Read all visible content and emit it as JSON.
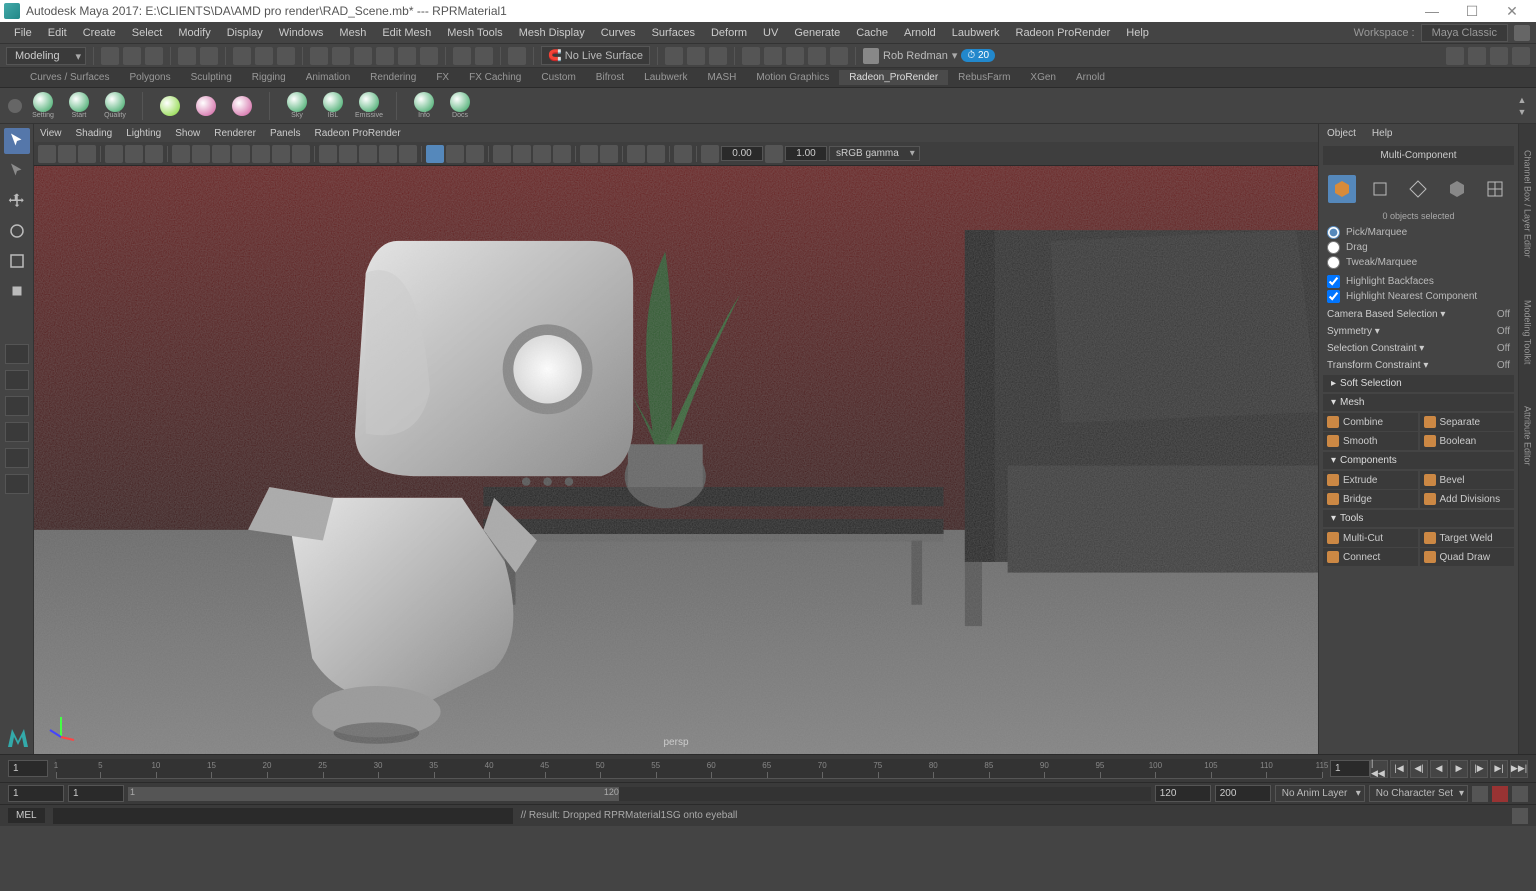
{
  "title": "Autodesk Maya 2017: E:\\CLIENTS\\DA\\AMD pro render\\RAD_Scene.mb*  ---  RPRMaterial1",
  "menus": [
    "File",
    "Edit",
    "Create",
    "Select",
    "Modify",
    "Display",
    "Windows",
    "Mesh",
    "Edit Mesh",
    "Mesh Tools",
    "Mesh Display",
    "Curves",
    "Surfaces",
    "Deform",
    "UV",
    "Generate",
    "Cache",
    "Arnold",
    "Laubwerk",
    "Radeon ProRender",
    "Help"
  ],
  "workspace": {
    "label": "Workspace :",
    "value": "Maya Classic"
  },
  "modedrop": "Modeling",
  "livesurface": "No Live Surface",
  "user": {
    "name": "Rob Redman",
    "badge": "20"
  },
  "shelves": [
    "Curves / Surfaces",
    "Polygons",
    "Sculpting",
    "Rigging",
    "Animation",
    "Rendering",
    "FX",
    "FX Caching",
    "Custom",
    "Bifrost",
    "Laubwerk",
    "MASH",
    "Motion Graphics",
    "Radeon_ProRender",
    "RebusFarm",
    "XGen",
    "Arnold"
  ],
  "shelf_active": "Radeon_ProRender",
  "shelf_icons": [
    {
      "lbl": "Setting",
      "color": "#2ca05a"
    },
    {
      "lbl": "Start",
      "color": "#2ca05a"
    },
    {
      "lbl": "Quality",
      "color": "#2ca05a"
    },
    {
      "lbl": "",
      "color": "#7fd32e",
      "sep_before": true
    },
    {
      "lbl": "",
      "color": "#cc5599"
    },
    {
      "lbl": "",
      "color": "#cc5599"
    },
    {
      "lbl": "Sky",
      "color": "#2ca05a",
      "sep_before": true
    },
    {
      "lbl": "IBL",
      "color": "#2ca05a"
    },
    {
      "lbl": "Emissive",
      "color": "#2ca05a"
    },
    {
      "lbl": "Info",
      "color": "#2ca05a",
      "sep_before": true
    },
    {
      "lbl": "Docs",
      "color": "#2ca05a"
    }
  ],
  "viewmenu": [
    "View",
    "Shading",
    "Lighting",
    "Show",
    "Renderer",
    "Panels",
    "Radeon ProRender"
  ],
  "viewtoolbar": {
    "num1": "0.00",
    "num2": "1.00",
    "gamma": "sRGB gamma"
  },
  "camera": "persp",
  "rightpanel": {
    "tabs": [
      "Object",
      "Help"
    ],
    "multicomp": "Multi-Component",
    "selcount": "0 objects selected",
    "radios": [
      "Pick/Marquee",
      "Drag",
      "Tweak/Marquee"
    ],
    "checks": [
      "Highlight Backfaces",
      "Highlight Nearest Component"
    ],
    "drops": [
      {
        "lbl": "Camera Based Selection",
        "val": "Off"
      },
      {
        "lbl": "Symmetry",
        "val": "Off"
      },
      {
        "lbl": "Selection Constraint",
        "val": "Off"
      },
      {
        "lbl": "Transform Constraint",
        "val": "Off"
      }
    ],
    "soft": "Soft Selection",
    "mesh_hdr": "Mesh",
    "mesh_btns": [
      [
        "Combine",
        "Separate"
      ],
      [
        "Smooth",
        "Boolean"
      ]
    ],
    "comp_hdr": "Components",
    "comp_btns": [
      [
        "Extrude",
        "Bevel"
      ],
      [
        "Bridge",
        "Add Divisions"
      ]
    ],
    "tools_hdr": "Tools",
    "tools_btns": [
      [
        "Multi-Cut",
        "Target Weld"
      ],
      [
        "Connect",
        "Quad Draw"
      ]
    ]
  },
  "sidetabs": [
    "Channel Box / Layer Editor",
    "Modeling Toolkit",
    "Attribute Editor"
  ],
  "timeline": {
    "current": "1",
    "endframe": "1",
    "ticks": [
      1,
      5,
      10,
      15,
      20,
      25,
      30,
      35,
      40,
      45,
      50,
      55,
      60,
      65,
      70,
      75,
      80,
      85,
      90,
      95,
      100,
      105,
      110,
      115
    ]
  },
  "range": {
    "start": "1",
    "rangestart": "1",
    "rangeend": "120",
    "end1": "120",
    "end2": "200",
    "animlayer": "No Anim Layer",
    "charset": "No Character Set"
  },
  "status": {
    "mode": "MEL",
    "result": "// Result: Dropped RPRMaterial1SG onto eyeball"
  }
}
